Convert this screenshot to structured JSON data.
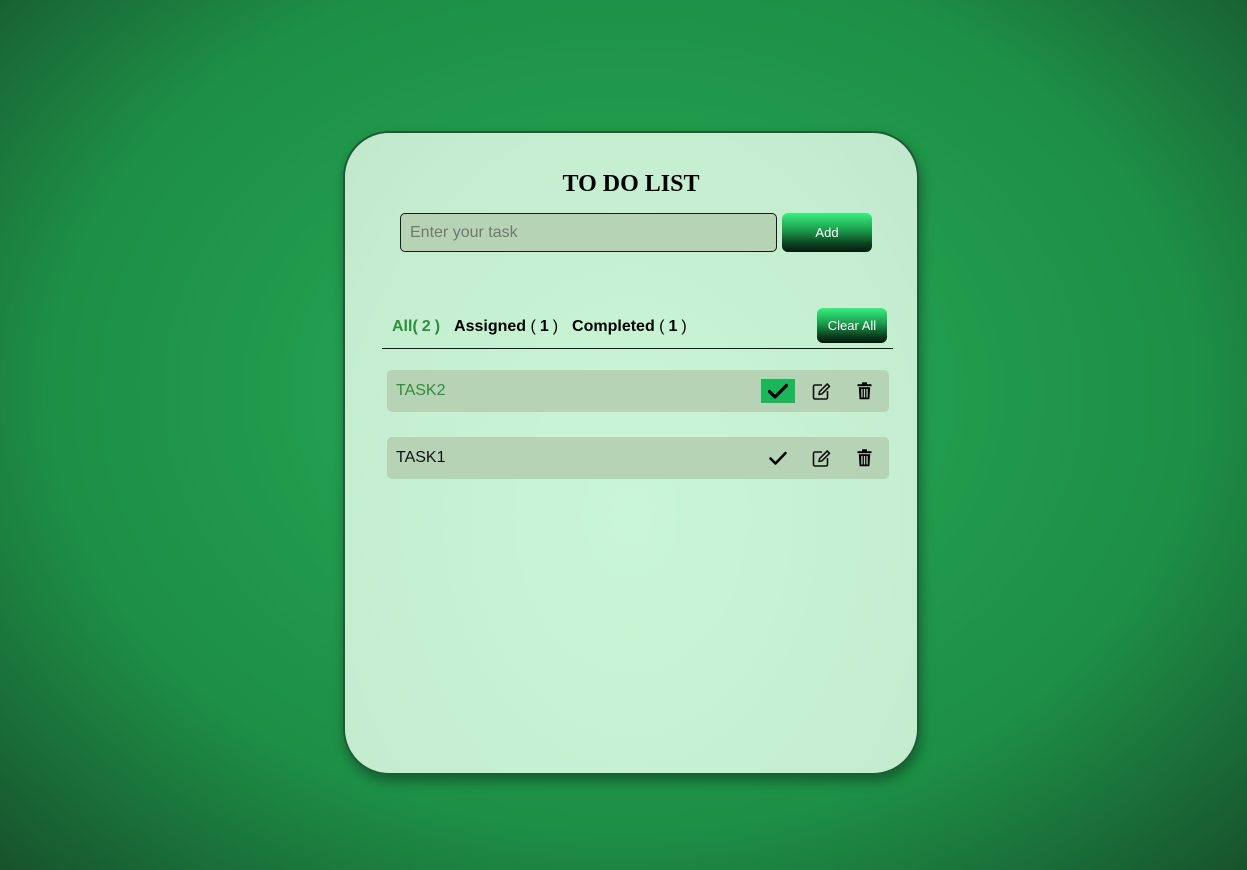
{
  "title": "TO DO LIST",
  "input": {
    "placeholder": "Enter your task",
    "value": ""
  },
  "add_button": "Add",
  "tabs": [
    {
      "label": "All",
      "count": "2",
      "active": true
    },
    {
      "label": "Assigned",
      "count": "1",
      "active": false
    },
    {
      "label": "Completed",
      "count": "1",
      "active": false
    }
  ],
  "clear_button": "Clear All",
  "tasks": [
    {
      "text": "TASK2",
      "completed": true,
      "icons": [
        "check-icon",
        "edit-icon",
        "trash-icon"
      ]
    },
    {
      "text": "TASK1",
      "completed": false,
      "icons": [
        "check-icon",
        "edit-icon",
        "trash-icon"
      ]
    }
  ],
  "colors": {
    "accent_green": "#2b8f3c",
    "check_active_bg": "#1bb55a",
    "task_bg": "#b7d3b5",
    "card_bg": "#c6efd2"
  }
}
